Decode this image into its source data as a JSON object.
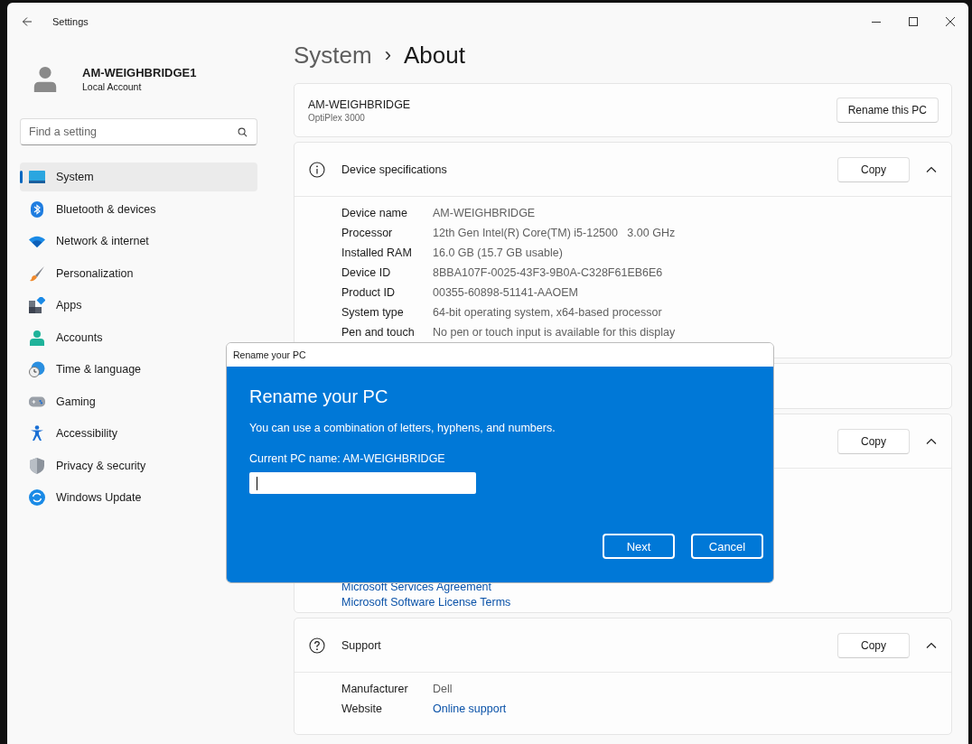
{
  "window": {
    "title": "Settings"
  },
  "account": {
    "name": "AM-WEIGHBRIDGE1",
    "type": "Local Account"
  },
  "search": {
    "placeholder": "Find a setting"
  },
  "sidebar": {
    "items": [
      {
        "label": "System",
        "selected": true
      },
      {
        "label": "Bluetooth & devices",
        "selected": false
      },
      {
        "label": "Network & internet",
        "selected": false
      },
      {
        "label": "Personalization",
        "selected": false
      },
      {
        "label": "Apps",
        "selected": false
      },
      {
        "label": "Accounts",
        "selected": false
      },
      {
        "label": "Time & language",
        "selected": false
      },
      {
        "label": "Gaming",
        "selected": false
      },
      {
        "label": "Accessibility",
        "selected": false
      },
      {
        "label": "Privacy & security",
        "selected": false
      },
      {
        "label": "Windows Update",
        "selected": false
      }
    ]
  },
  "breadcrumb": {
    "parent": "System",
    "separator": "›",
    "current": "About"
  },
  "pc_card": {
    "name": "AM-WEIGHBRIDGE",
    "model": "OptiPlex 3000",
    "button": "Rename this PC"
  },
  "sections": [
    {
      "kind": "specs",
      "title": "Device specifications",
      "copy_button": "Copy",
      "expanded": true,
      "rows": [
        {
          "label": "Device name",
          "value": "AM-WEIGHBRIDGE",
          "kind": "text"
        },
        {
          "label": "Processor",
          "value": "12th Gen Intel(R) Core(TM) i5-12500   3.00 GHz",
          "kind": "text"
        },
        {
          "label": "Installed RAM",
          "value": "16.0 GB (15.7 GB usable)",
          "kind": "text"
        },
        {
          "label": "Device ID",
          "value": "8BBA107F-0025-43F3-9B0A-C328F61EB6E6",
          "kind": "text"
        },
        {
          "label": "Product ID",
          "value": "00355-60898-51141-AAOEM",
          "kind": "text"
        },
        {
          "label": "System type",
          "value": "64-bit operating system, x64-based processor",
          "kind": "text"
        },
        {
          "label": "Pen and touch",
          "value": "No pen or touch input is available for this display",
          "kind": "text"
        }
      ]
    },
    {
      "kind": "blank"
    },
    {
      "kind": "links",
      "copy_button": "Copy",
      "expanded": true,
      "links": [
        "Microsoft Services Agreement",
        "Microsoft Software License Terms"
      ]
    },
    {
      "kind": "specs",
      "title": "Support",
      "copy_button": "Copy",
      "expanded": true,
      "rows": [
        {
          "label": "Manufacturer",
          "value": "Dell",
          "kind": "text"
        },
        {
          "label": "Website",
          "value": "Online support",
          "kind": "link"
        }
      ]
    }
  ],
  "dialog": {
    "window_title": "Rename your PC",
    "heading": "Rename your PC",
    "message": "You can use a combination of letters, hyphens, and numbers.",
    "current_name": "Current PC name: AM-WEIGHBRIDGE",
    "buttons": [
      "Next",
      "Cancel"
    ]
  }
}
